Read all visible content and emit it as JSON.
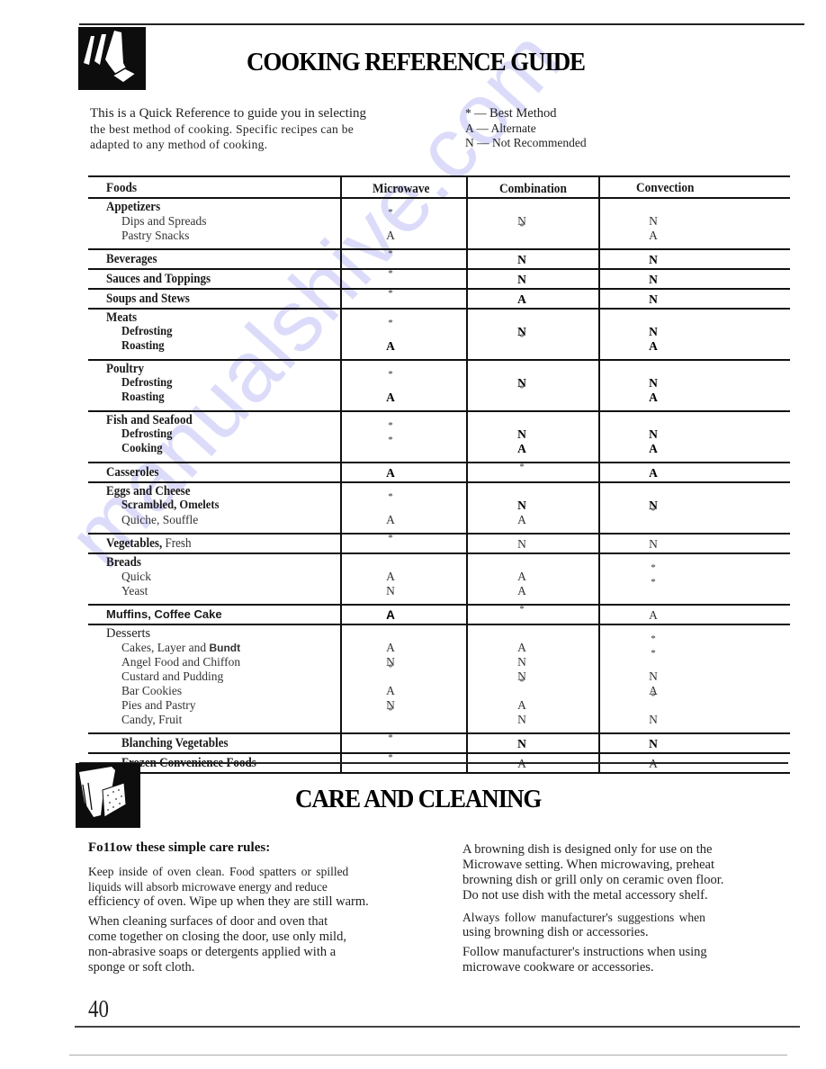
{
  "reference_guide": {
    "title": "COOKING REFERENCE GUIDE",
    "icon": "hand-pressing-pad-icon",
    "intro_lines": [
      "This is a Quick Reference to guide you in selecting",
      "the best method of cooking. Specific recipes can be",
      "adapted to any method of cooking."
    ],
    "legend": [
      {
        "symbol": "*",
        "meaning": "Best Method"
      },
      {
        "symbol": "A",
        "meaning": "Alternate"
      },
      {
        "symbol": "N",
        "meaning": "Not Recommended"
      }
    ],
    "table": {
      "headers": [
        "Foods",
        "Microwave",
        "Combination",
        "Convection"
      ],
      "rows": [
        {
          "group": "Appetizers",
          "items": [
            {
              "label": "Dips and Spreads",
              "microwave": "*",
              "combination": "N",
              "convection": "N"
            },
            {
              "label": "Pastry Snacks",
              "microwave": "A",
              "combination": "*",
              "convection": "A"
            }
          ]
        },
        {
          "label": "Beverages",
          "microwave": "*",
          "combination": "N",
          "convection": "N"
        },
        {
          "label": "Sauces and Toppings",
          "microwave": "*",
          "combination": "N",
          "convection": "N"
        },
        {
          "label": "Soups and Stews",
          "microwave": "*",
          "combination": "A",
          "convection": "N"
        },
        {
          "group": "Meats",
          "items": [
            {
              "label": "Defrosting",
              "microwave": "*",
              "combination": "N",
              "convection": "N"
            },
            {
              "label": "Roasting",
              "microwave": "A",
              "combination": "*",
              "convection": "A"
            }
          ]
        },
        {
          "group": "Poultry",
          "items": [
            {
              "label": "Defrosting",
              "microwave": "*",
              "combination": "N",
              "convection": "N"
            },
            {
              "label": "Roasting",
              "microwave": "A",
              "combination": "*",
              "convection": "A"
            }
          ]
        },
        {
          "group": "Fish and Seafood",
          "items": [
            {
              "label": "Defrosting",
              "microwave": "*",
              "combination": "N",
              "convection": "N"
            },
            {
              "label": "Cooking",
              "microwave": "*",
              "combination": "A",
              "convection": "A"
            }
          ]
        },
        {
          "label": "Casseroles",
          "microwave": "A",
          "combination": "*",
          "convection": "A"
        },
        {
          "group": "Eggs and Cheese",
          "items": [
            {
              "label": "Scrambled, Omelets",
              "microwave": "*",
              "combination": "N",
              "convection": "N"
            },
            {
              "label": "Quiche, Souffle",
              "microwave": "A",
              "combination": "A",
              "convection": "*"
            }
          ]
        },
        {
          "label": "Vegetables,",
          "label_suffix": "Fresh",
          "microwave": "*",
          "combination": "N",
          "convection": "N"
        },
        {
          "group": "Breads",
          "items": [
            {
              "label": "Quick",
              "microwave": "A",
              "combination": "A",
              "convection": "*"
            },
            {
              "label": "Yeast",
              "microwave": "N",
              "combination": "A",
              "convection": "*"
            }
          ]
        },
        {
          "label": "Muffins, Coffee Cake",
          "microwave": "A",
          "combination": "*",
          "convection": "A"
        },
        {
          "group": "Desserts",
          "items": [
            {
              "label": "Cakes, Layer and",
              "label_suffix": "Bundt",
              "microwave": "A",
              "combination": "A",
              "convection": "*"
            },
            {
              "label": "Angel Food and Chiffon",
              "microwave": "N",
              "combination": "N",
              "convection": "*"
            },
            {
              "label": "Custard and Pudding",
              "microwave": "*",
              "combination": "N",
              "convection": "N"
            },
            {
              "label": "Bar Cookies",
              "microwave": "A",
              "combination": "*",
              "convection": "A"
            },
            {
              "label": "Pies and Pastry",
              "microwave": "N",
              "combination": "A",
              "convection": "*"
            },
            {
              "label": "Candy, Fruit",
              "microwave": "*",
              "combination": "N",
              "convection": "N"
            }
          ]
        },
        {
          "label": "Blanching Vegetables",
          "microwave": "*",
          "combination": "N",
          "convection": "N"
        },
        {
          "label": "Frozen Convenience Foods",
          "microwave": "*",
          "combination": "A",
          "convection": "A"
        }
      ]
    }
  },
  "care_cleaning": {
    "title": "CARE AND CLEANING",
    "icon": "hand-holding-sponge-icon",
    "heading": "Fo11ow these simple care rules:",
    "left_paragraphs": [
      [
        "Keep inside of oven clean. Food spatters or spilled",
        "liquids will absorb microwave energy and reduce",
        "efficiency of oven. Wipe up when they are still warm."
      ],
      [
        "When cleaning surfaces of door and oven that",
        "come together on closing the door, use only mild,",
        "non-abrasive soaps or detergents applied with a",
        "sponge or soft cloth."
      ]
    ],
    "right_paragraphs": [
      [
        "A browning dish is designed only for use on the",
        "Microwave setting. When microwaving, preheat",
        "browning dish or grill only on ceramic oven floor.",
        "Do not use dish with the metal accessory shelf."
      ],
      [
        "Always follow manufacturer's suggestions when",
        "using browning dish or accessories."
      ],
      [
        "Follow manufacturer's instructions when using",
        "microwave cookware or accessories."
      ]
    ]
  },
  "page_number": "40",
  "watermark": "manualshive.com"
}
